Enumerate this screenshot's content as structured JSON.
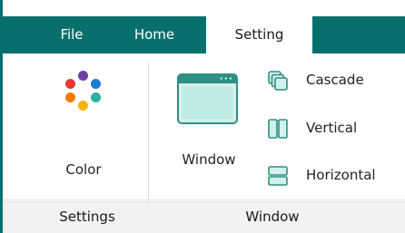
{
  "tabs": {
    "file": "File",
    "home": "Home",
    "setting": "Setting",
    "active": "Setting"
  },
  "ribbon": {
    "color_button": {
      "label": "Color",
      "icon": "color-palette-icon"
    },
    "window_button": {
      "label": "Window",
      "icon": "window-icon",
      "has_dropdown": true
    },
    "arrange": [
      {
        "label": "Cascade",
        "icon": "cascade-icon"
      },
      {
        "label": "Vertical",
        "icon": "tile-vertical-icon"
      },
      {
        "label": "Horizontal",
        "icon": "tile-horizontal-icon"
      }
    ]
  },
  "groups": {
    "settings": "Settings",
    "window": "Window"
  },
  "colors": {
    "accent": "#08706c",
    "icon_stroke": "#2e8f85",
    "icon_fill": "#d3f0ea",
    "palette_dots": [
      "#6d3fa2",
      "#1e7bd0",
      "#e53935",
      "#2bb0a0",
      "#f5b400",
      "#ff7a00"
    ]
  }
}
